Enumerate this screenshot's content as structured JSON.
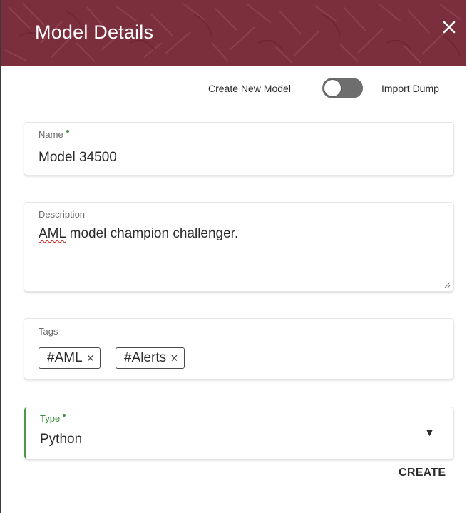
{
  "dialog": {
    "title": "Model Details",
    "close_icon": "close-icon"
  },
  "mode_toggle": {
    "left_label": "Create New Model",
    "right_label": "Import Dump",
    "checked": false
  },
  "fields": {
    "name": {
      "label": "Name",
      "required": true,
      "value": "Model 34500"
    },
    "description": {
      "label": "Description",
      "value_prefix": "AML",
      "value_rest": " model champion challenger."
    },
    "tags": {
      "label": "Tags",
      "items": [
        {
          "label": "#AML"
        },
        {
          "label": "#Alerts"
        }
      ],
      "remove_glyph": "×"
    },
    "type": {
      "label": "Type",
      "required": true,
      "value": "Python",
      "dropdown_icon": "caret-down-icon"
    }
  },
  "actions": {
    "create_label": "CREATE"
  },
  "colors": {
    "header": "#7b2f3c",
    "required_dot": "#3f8f3f",
    "active_border": "#4a9a4a"
  }
}
